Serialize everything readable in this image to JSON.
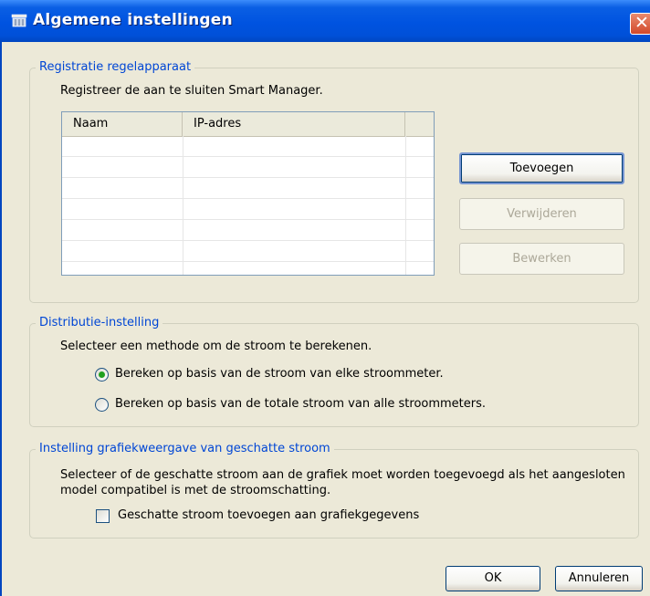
{
  "window": {
    "title": "Algemene instellingen"
  },
  "registration": {
    "legend": "Registratie regelapparaat",
    "description": "Registreer de aan te sluiten Smart Manager.",
    "table": {
      "columns": [
        "Naam",
        "IP-adres"
      ],
      "rows": []
    },
    "add_label": "Toevoegen",
    "delete_label": "Verwijderen",
    "edit_label": "Bewerken"
  },
  "distribution": {
    "legend": "Distributie-instelling",
    "description": "Selecteer een methode om de stroom te berekenen.",
    "options": [
      {
        "label": "Bereken op basis van de stroom van elke stroommeter.",
        "selected": true
      },
      {
        "label": "Bereken op basis van de totale stroom van alle stroommeters.",
        "selected": false
      }
    ]
  },
  "graph": {
    "legend": "Instelling grafiekweergave van geschatte stroom",
    "description_line1": "Selecteer of de geschatte stroom aan de grafiek moet worden toegevoegd als het aangesloten",
    "description_line2": "model compatibel is met de stroomschatting.",
    "checkbox_label": "Geschatte stroom toevoegen aan grafiekgegevens",
    "checked": false
  },
  "footer": {
    "ok_label": "OK",
    "cancel_label": "Annuleren"
  },
  "colors": {
    "titlebar": "#0053e0",
    "legend_text": "#0046d5",
    "window_bg": "#ece9d8"
  }
}
